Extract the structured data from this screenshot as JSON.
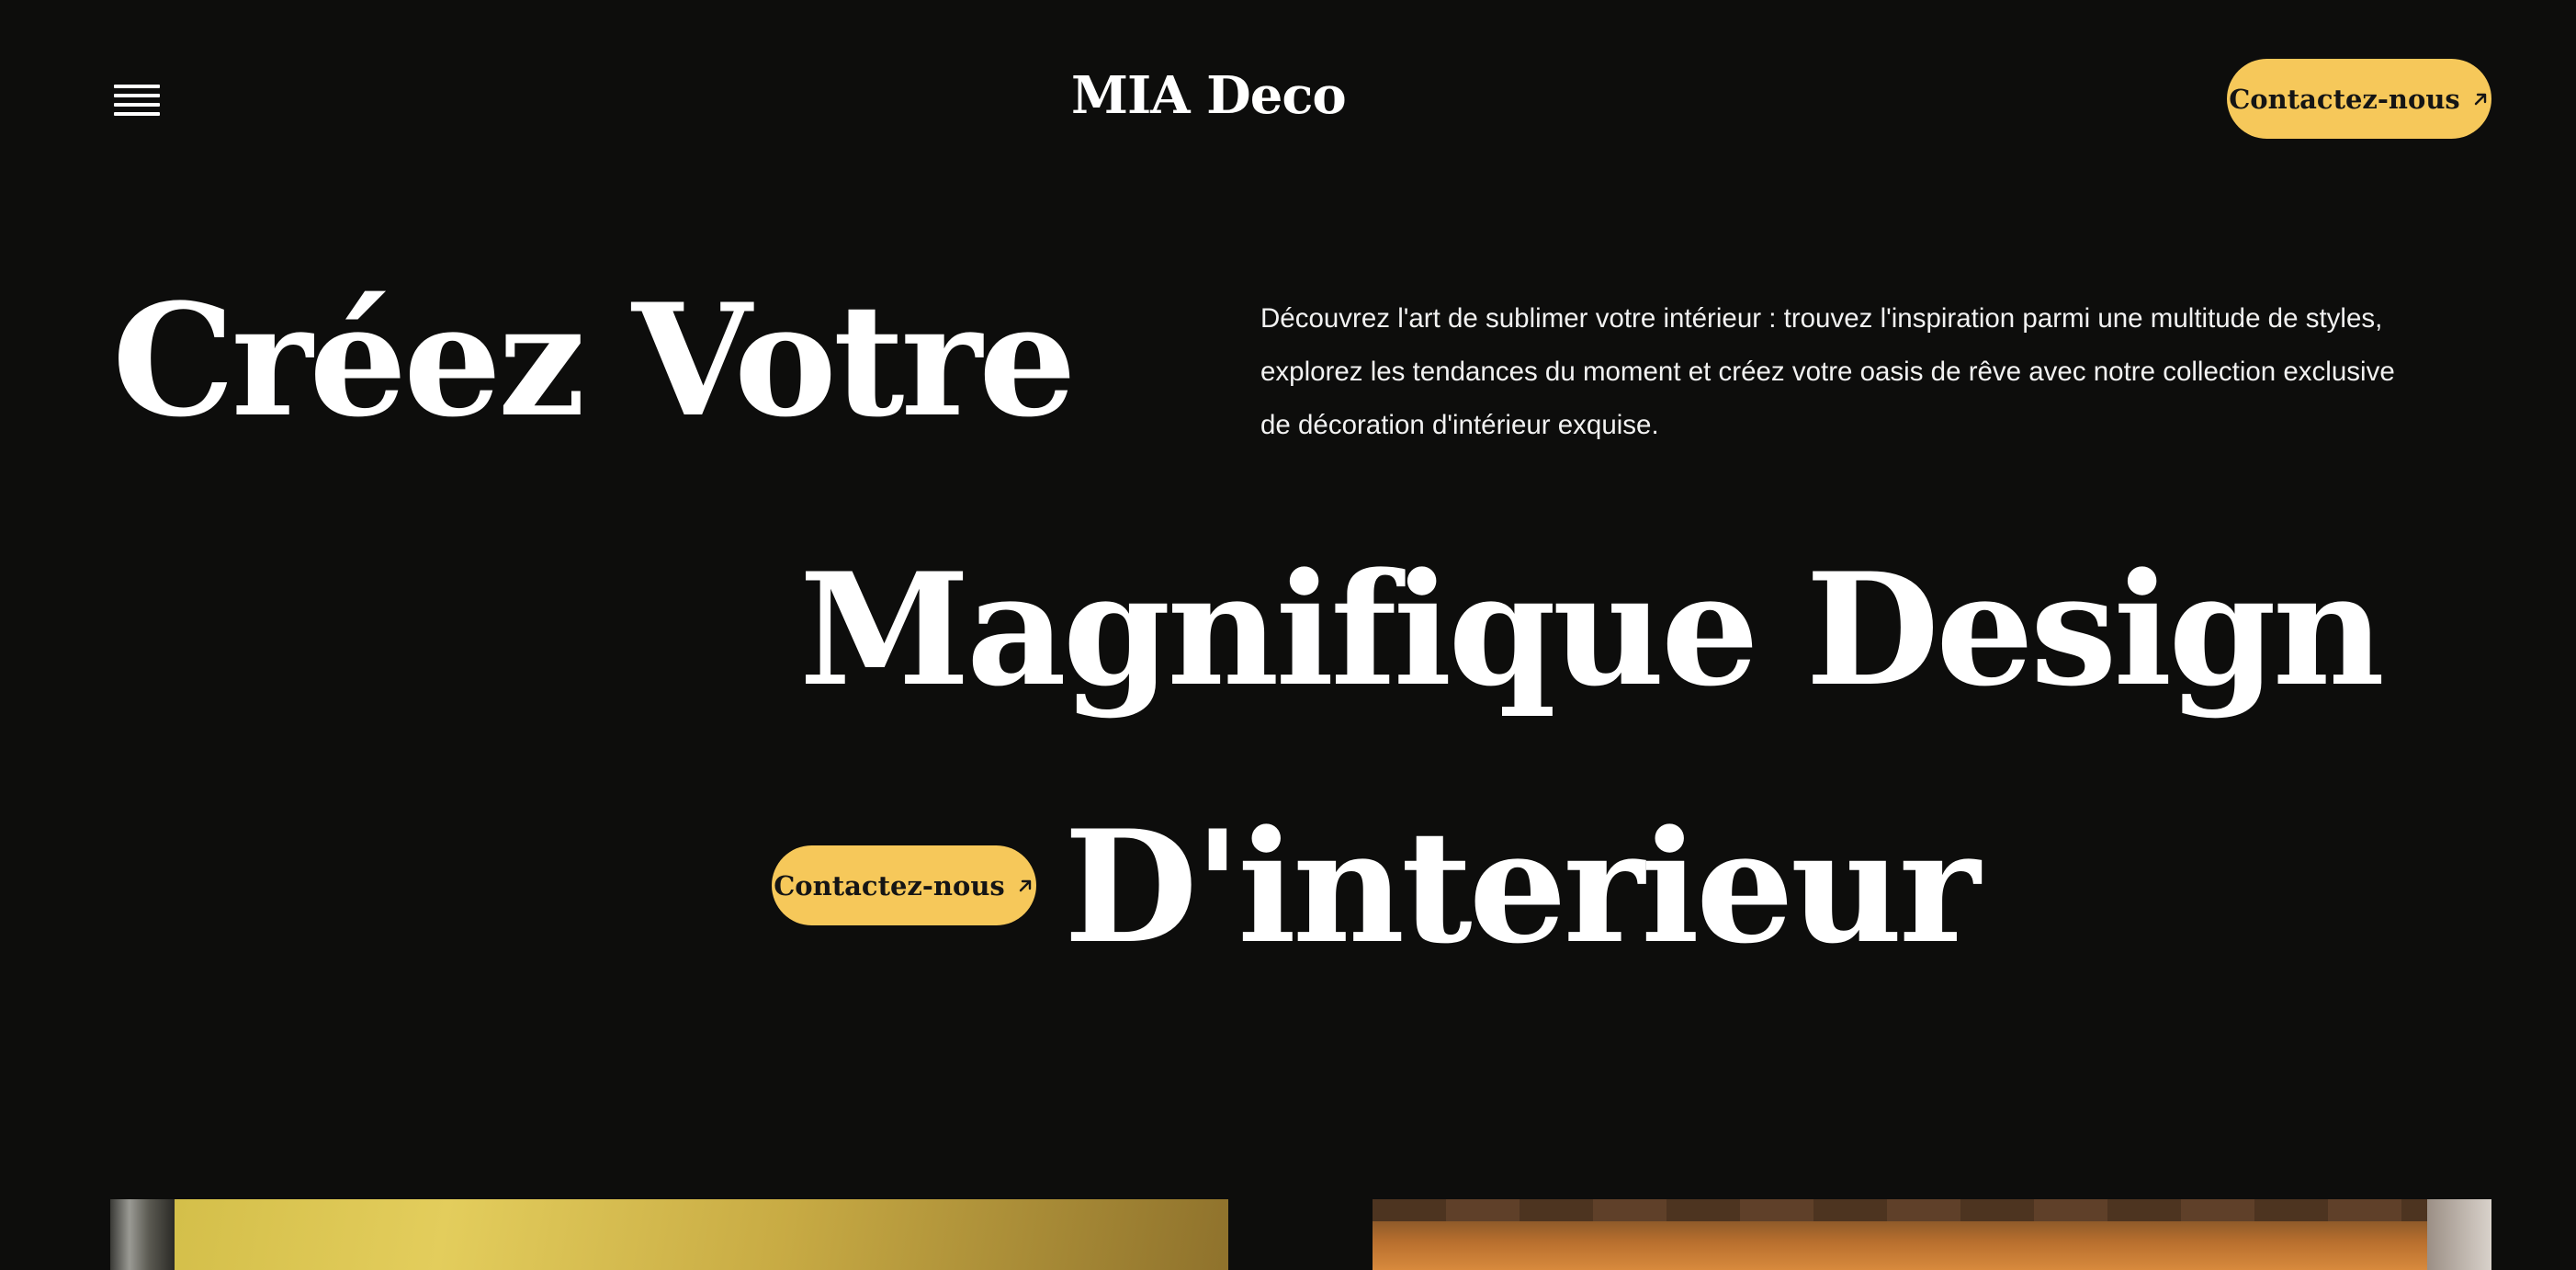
{
  "header": {
    "menu_icon": "hamburger-menu-icon",
    "brand": "MIA Deco",
    "cta_label": "Contactez-nous",
    "cta_icon": "arrow-up-right-icon"
  },
  "hero": {
    "title_line1": "Créez Votre",
    "title_line2": "Magnifique Design",
    "title_line3": "D'interieur",
    "intro": "Découvrez l'art de sublimer votre intérieur : trouvez l'inspiration parmi une multitude de styles, explorez les tendances du moment et créez votre oasis de rêve avec notre collection exclusive de décoration d'intérieur exquise.",
    "cta_label": "Contactez-nous",
    "cta_icon": "arrow-up-right-icon"
  },
  "gallery": {
    "images": [
      "yellow-interior-image",
      "orange-interior-image"
    ]
  },
  "colors": {
    "background": "#0d0d0c",
    "accent": "#f6c85a",
    "text": "#ffffff"
  }
}
